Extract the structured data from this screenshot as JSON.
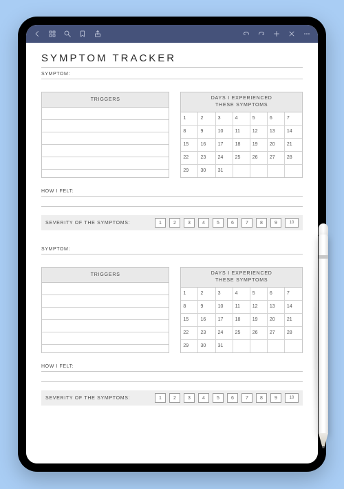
{
  "toolbar": {
    "left_icons": [
      "back-icon",
      "thumbnails-icon",
      "search-icon",
      "bookmark-icon",
      "share-icon"
    ],
    "right_icons": [
      "undo-icon",
      "redo-icon",
      "add-icon",
      "close-icon",
      "more-icon"
    ]
  },
  "doc": {
    "title": "SYMPTOM TRACKER",
    "blocks": [
      {
        "symptom_label": "SYMPTOM:",
        "triggers_header": "TRIGGERS",
        "days_header": "DAYS I EXPERIENCED\nTHESE SYMPTOMS",
        "days": [
          1,
          2,
          3,
          4,
          5,
          6,
          7,
          8,
          9,
          10,
          11,
          12,
          13,
          14,
          15,
          16,
          17,
          18,
          19,
          20,
          21,
          22,
          23,
          24,
          25,
          26,
          27,
          28,
          29,
          30,
          31,
          "",
          "",
          "",
          ""
        ],
        "how_label": "HOW I FELT:",
        "severity_label": "SEVERITY OF THE SYMPTOMS:",
        "severity_scale": [
          1,
          2,
          3,
          4,
          5,
          6,
          7,
          8,
          9,
          10
        ]
      },
      {
        "symptom_label": "SYMPTOM:",
        "triggers_header": "TRIGGERS",
        "days_header": "DAYS I EXPERIENCED\nTHESE SYMPTOMS",
        "days": [
          1,
          2,
          3,
          4,
          5,
          6,
          7,
          8,
          9,
          10,
          11,
          12,
          13,
          14,
          15,
          16,
          17,
          18,
          19,
          20,
          21,
          22,
          23,
          24,
          25,
          26,
          27,
          28,
          29,
          30,
          31,
          "",
          "",
          "",
          ""
        ],
        "how_label": "HOW I FELT:",
        "severity_label": "SEVERITY OF THE SYMPTOMS:",
        "severity_scale": [
          1,
          2,
          3,
          4,
          5,
          6,
          7,
          8,
          9,
          10
        ]
      }
    ]
  }
}
